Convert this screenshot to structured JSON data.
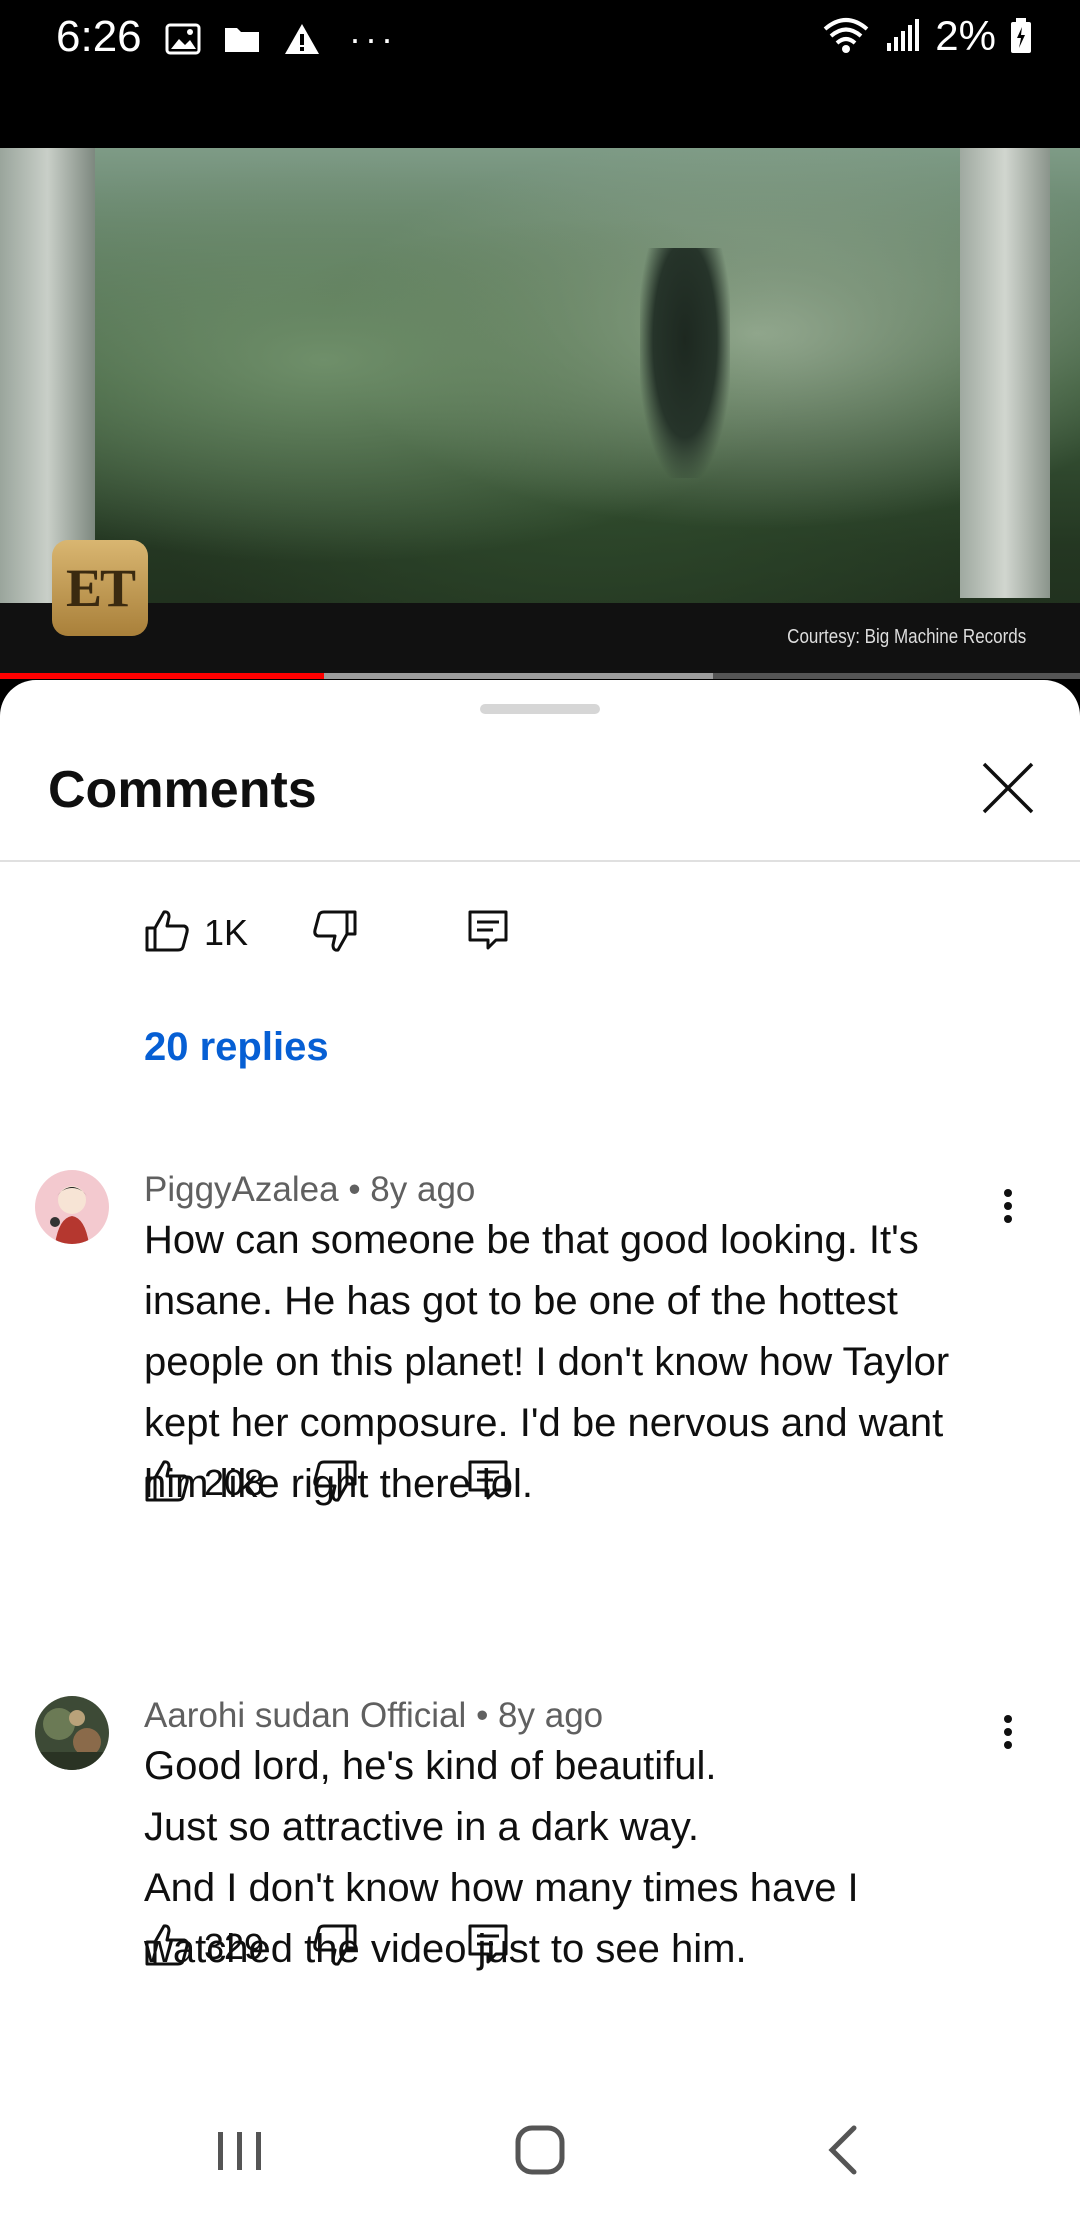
{
  "status_bar": {
    "time": "6:26",
    "battery": "2%",
    "more": "···"
  },
  "video": {
    "logo": "ET",
    "courtesy": "Courtesy: Big Machine Records",
    "progress_fraction": 0.3,
    "buffer_fraction": 0.66,
    "accent": "#ff0000"
  },
  "comments_sheet": {
    "title": "Comments",
    "top_actions": {
      "likes": "1K"
    },
    "replies_link": "20 replies",
    "comments": [
      {
        "author": "PiggyAzalea",
        "age": "8y ago",
        "text": "How can someone be that good looking. It's insane. He has got to be one of the hottest people on this planet! I don't know how Taylor kept her composure. I'd be nervous and want him like right there lol.",
        "likes": "208"
      },
      {
        "author": "Aarohi sudan Official",
        "age": "8y ago",
        "text": "Good lord, he's kind of beautiful.\nJust so attractive in a dark way.\nAnd I don't know how many times have I watched the video just to see him.",
        "likes": "329"
      }
    ],
    "link_color": "#065fd4"
  },
  "icons": [
    "gallery-icon",
    "folder-icon",
    "warning-icon",
    "wifi-icon",
    "signal-icon",
    "battery-icon",
    "close-icon",
    "thumbs-up-icon",
    "thumbs-down-icon",
    "reply-icon",
    "more-vert-icon",
    "recents-icon",
    "home-icon",
    "back-icon"
  ]
}
